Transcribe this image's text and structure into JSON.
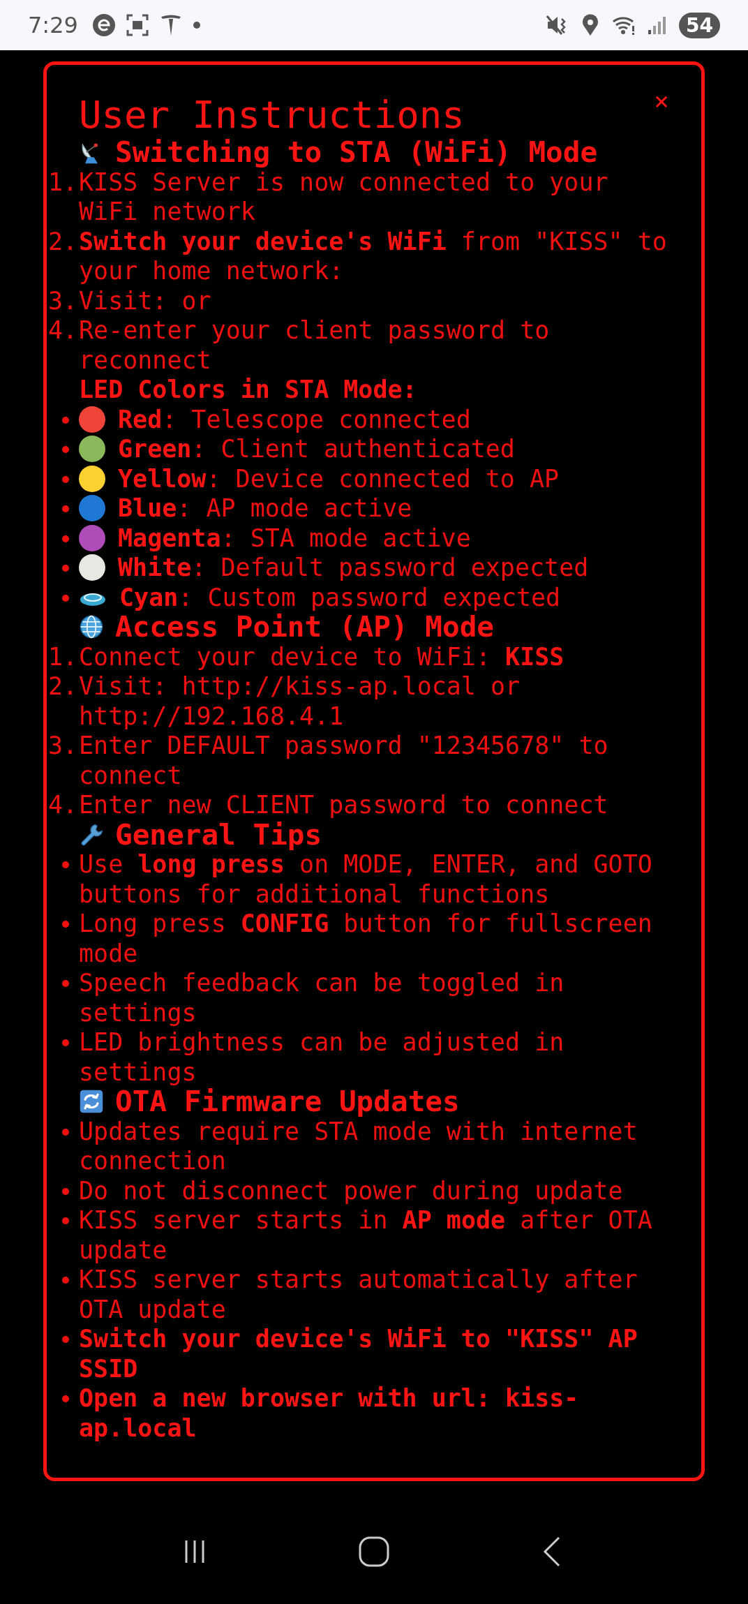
{
  "status_bar": {
    "time": "7:29",
    "battery": "54"
  },
  "dialog": {
    "title": "User Instructions",
    "close": "×",
    "sections": [
      {
        "heading": "Switching to STA (WiFi) Mode",
        "kind": "ordered",
        "items": [
          {
            "number": "1.",
            "text": "KISS Server is now connected to your WiFi network"
          },
          {
            "number": "2.",
            "text": "**Switch your device's WiFi** from \"KISS\" to your home network:"
          },
          {
            "number": "3.",
            "text": "Visit: or"
          },
          {
            "number": "4.",
            "text": "Re-enter your client password to reconnect"
          }
        ],
        "subheading": "LED Colors in STA Mode:",
        "led_colors": [
          {
            "text": "**Red**: Telescope connected",
            "color": "#f04438"
          },
          {
            "text": "**Green**: Client authenticated",
            "color": "#8bb85a"
          },
          {
            "text": "**Yellow**: Device connected to AP",
            "color": "#fcd232"
          },
          {
            "text": "**Blue**: AP mode active",
            "color": "#1e78d4"
          },
          {
            "text": "**Magenta**: STA mode active",
            "color": "#b04cb8"
          },
          {
            "text": "**White**: Default password expected",
            "color": "#e8e8e2"
          },
          {
            "text": "**Cyan**: Custom password expected",
            "color": "#3aa8d0"
          }
        ]
      },
      {
        "heading": "Access Point (AP) Mode",
        "kind": "ordered",
        "items": [
          {
            "number": "1.",
            "text": "Connect your device to WiFi: **KISS**"
          },
          {
            "number": "2.",
            "text": "Visit: http://kiss-ap.local or http://192.168.4.1"
          },
          {
            "number": "3.",
            "text": "Enter DEFAULT password \"12345678\" to connect"
          },
          {
            "number": "4.",
            "text": "Enter new CLIENT password to connect"
          }
        ]
      },
      {
        "heading": "General Tips",
        "kind": "bullet",
        "items": [
          {
            "text": "Use **long press** on MODE, ENTER, and GOTO buttons for additional functions"
          },
          {
            "text": "Long press **CONFIG** button for fullscreen mode"
          },
          {
            "text": "Speech feedback can be toggled in settings"
          },
          {
            "text": "LED brightness can be adjusted in settings"
          }
        ]
      },
      {
        "heading": "OTA Firmware Updates",
        "kind": "bullet",
        "items": [
          {
            "text": "Updates require STA mode with internet connection"
          },
          {
            "text": "Do not disconnect power during update"
          },
          {
            "text": "KISS server starts in **AP mode** after OTA update"
          },
          {
            "text": "KISS server starts automatically after OTA update"
          },
          {
            "text": "**Switch your device's WiFi to \"KISS\" AP SSID**"
          },
          {
            "text": "**Open a new browser with url: kiss-ap.local**"
          }
        ]
      }
    ]
  }
}
